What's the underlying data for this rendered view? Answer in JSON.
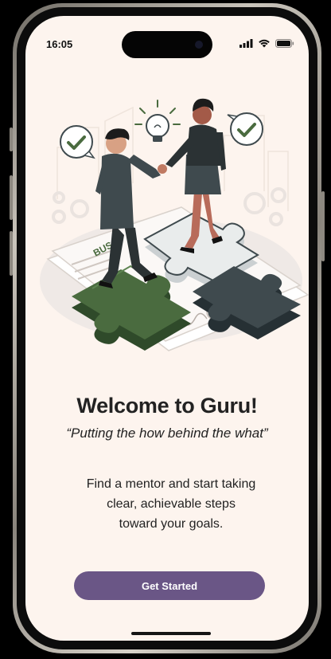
{
  "status_bar": {
    "time": "16:05",
    "icons": [
      "cellular-signal-icon",
      "wifi-icon",
      "battery-icon"
    ]
  },
  "illustration": {
    "subject": "two people shaking hands on connected puzzle pieces",
    "puzzle_text": "BUS"
  },
  "welcome": {
    "title": "Welcome to Guru!",
    "tagline": "“Putting the how behind the what”",
    "description_lines": [
      "Find a mentor and start taking",
      "clear, achievable steps",
      "toward your goals."
    ]
  },
  "cta": {
    "label": "Get Started"
  },
  "colors": {
    "background": "#fdf4ee",
    "accent": "#6a5686",
    "puzzle_green": "#4a6b3f",
    "puzzle_slate": "#3f4a4e",
    "text": "#222222"
  }
}
